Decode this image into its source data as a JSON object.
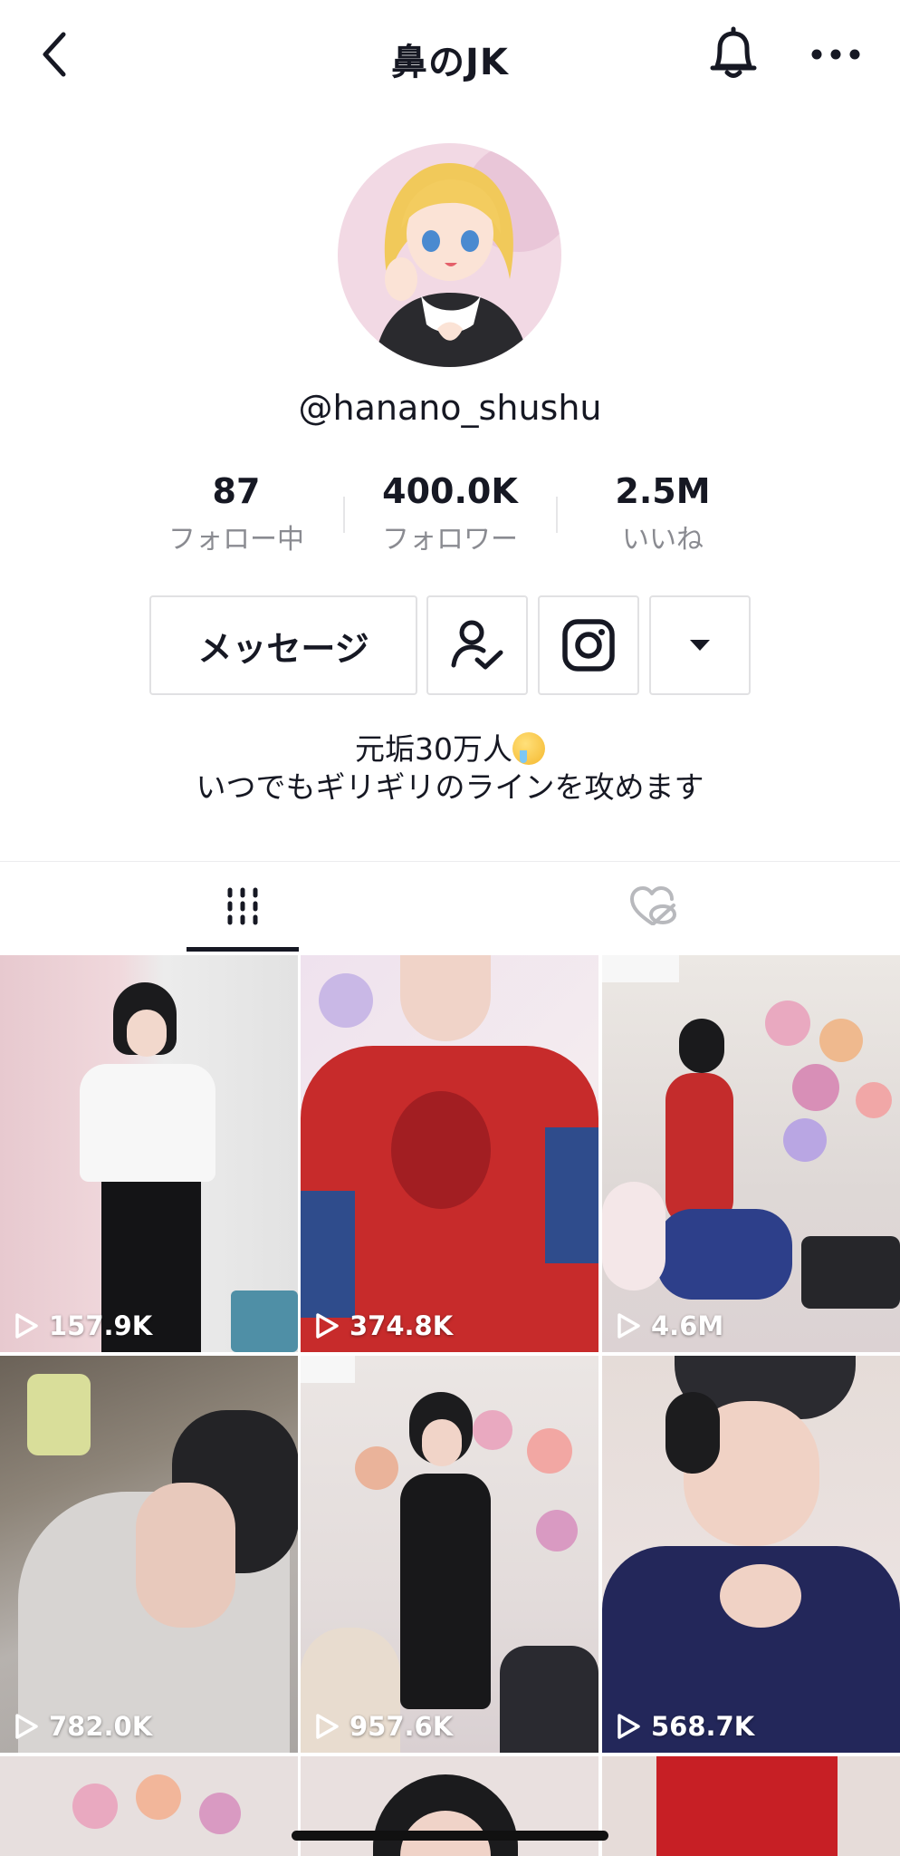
{
  "header": {
    "title": "鼻のJK",
    "back_icon": "chevron-left-icon",
    "bell_icon": "bell-icon",
    "more_icon": "more-horizontal-icon"
  },
  "profile": {
    "username": "@hanano_shushu",
    "stats": [
      {
        "value": "87",
        "label": "フォロー中"
      },
      {
        "value": "400.0K",
        "label": "フォロワー"
      },
      {
        "value": "2.5M",
        "label": "いいね"
      }
    ],
    "message_button": "メッセージ",
    "bio_line1": "元垢30万人",
    "bio_line2": "いつでもギリギリのラインを攻めます"
  },
  "tabs": [
    {
      "name": "videos",
      "icon": "grid-icon",
      "selected": true
    },
    {
      "name": "liked",
      "icon": "heart-lock-icon",
      "selected": false
    }
  ],
  "videos": [
    {
      "views": "157.9K"
    },
    {
      "views": "374.8K"
    },
    {
      "views": "4.6M"
    },
    {
      "views": "782.0K"
    },
    {
      "views": "957.6K"
    },
    {
      "views": "568.7K"
    }
  ],
  "colors": {
    "text": "#161823",
    "secondary": "#8a8b91",
    "border": "#e1e1e3"
  }
}
